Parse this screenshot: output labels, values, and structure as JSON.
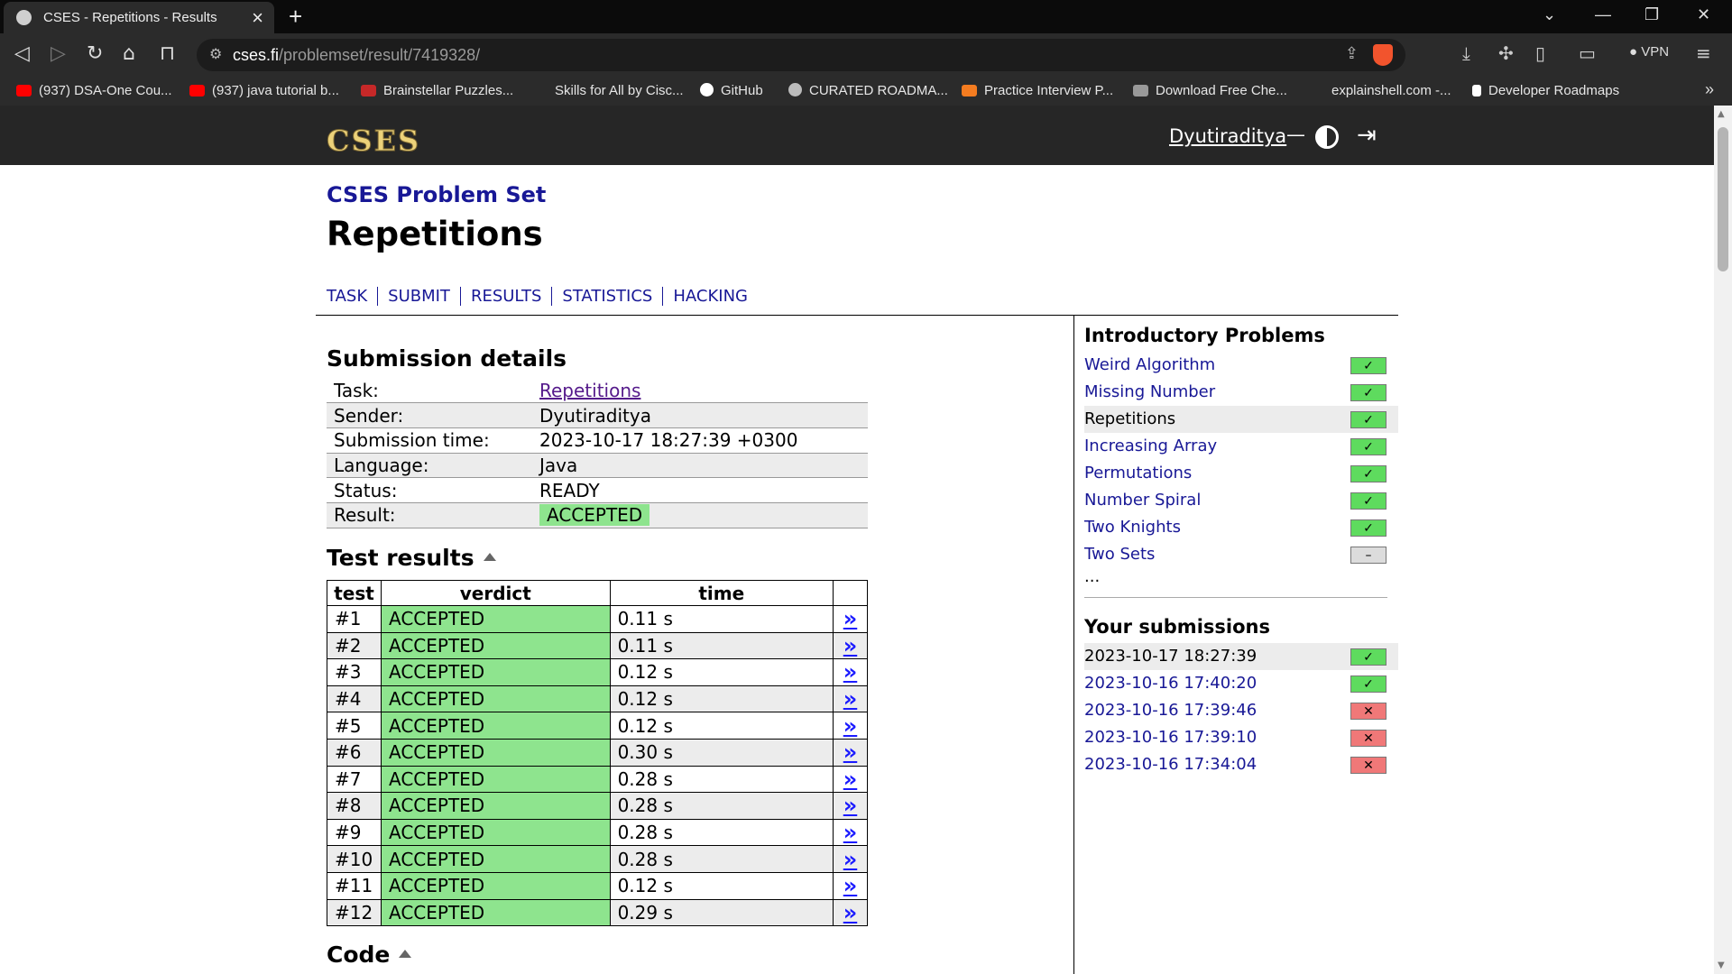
{
  "browser": {
    "tab_title": "CSES - Repetitions - Results",
    "url_host": "cses.fi",
    "url_path": "/problemset/result/7419328/",
    "vpn_label": "VPN",
    "bookmarks": [
      {
        "label": "(937) DSA-One Cou...",
        "icon": "youtube-icon"
      },
      {
        "label": "(937) java tutorial b...",
        "icon": "youtube-icon"
      },
      {
        "label": "Brainstellar Puzzles...",
        "icon": "star-icon"
      },
      {
        "label": "Skills for All by Cisc...",
        "icon": "cisco-icon"
      },
      {
        "label": "GitHub",
        "icon": "github-icon"
      },
      {
        "label": "CURATED ROADMA...",
        "icon": "globe-icon"
      },
      {
        "label": "Practice Interview P...",
        "icon": "codechef-icon"
      },
      {
        "label": "Download Free Che...",
        "icon": "bracket-icon"
      },
      {
        "label": "explainshell.com -...",
        "icon": "none"
      },
      {
        "label": "Developer Roadmaps",
        "icon": "roadmap-icon"
      }
    ]
  },
  "header": {
    "logo": "CSES",
    "username": "Dyutiraditya",
    "separator": "—"
  },
  "page": {
    "problemset_link": "CSES Problem Set",
    "title": "Repetitions",
    "tabs": [
      "TASK",
      "SUBMIT",
      "RESULTS",
      "STATISTICS",
      "HACKING"
    ]
  },
  "submission": {
    "heading": "Submission details",
    "rows": [
      {
        "key": "Task:",
        "value": "Repetitions"
      },
      {
        "key": "Sender:",
        "value": "Dyutiraditya"
      },
      {
        "key": "Submission time:",
        "value": "2023-10-17 18:27:39 +0300"
      },
      {
        "key": "Language:",
        "value": "Java"
      },
      {
        "key": "Status:",
        "value": "READY"
      },
      {
        "key": "Result:",
        "value": "ACCEPTED"
      }
    ]
  },
  "tests": {
    "heading": "Test results",
    "columns": [
      "test",
      "verdict",
      "time"
    ],
    "link_glyph": "»",
    "rows": [
      {
        "test": "#1",
        "verdict": "ACCEPTED",
        "time": "0.11 s"
      },
      {
        "test": "#2",
        "verdict": "ACCEPTED",
        "time": "0.11 s"
      },
      {
        "test": "#3",
        "verdict": "ACCEPTED",
        "time": "0.12 s"
      },
      {
        "test": "#4",
        "verdict": "ACCEPTED",
        "time": "0.12 s"
      },
      {
        "test": "#5",
        "verdict": "ACCEPTED",
        "time": "0.12 s"
      },
      {
        "test": "#6",
        "verdict": "ACCEPTED",
        "time": "0.30 s"
      },
      {
        "test": "#7",
        "verdict": "ACCEPTED",
        "time": "0.28 s"
      },
      {
        "test": "#8",
        "verdict": "ACCEPTED",
        "time": "0.28 s"
      },
      {
        "test": "#9",
        "verdict": "ACCEPTED",
        "time": "0.28 s"
      },
      {
        "test": "#10",
        "verdict": "ACCEPTED",
        "time": "0.28 s"
      },
      {
        "test": "#11",
        "verdict": "ACCEPTED",
        "time": "0.12 s"
      },
      {
        "test": "#12",
        "verdict": "ACCEPTED",
        "time": "0.29 s"
      }
    ]
  },
  "code_heading": "Code",
  "sidebar": {
    "problems_heading": "Introductory Problems",
    "problems": [
      {
        "name": "Weird Algorithm",
        "status": "solved",
        "current": false
      },
      {
        "name": "Missing Number",
        "status": "solved",
        "current": false
      },
      {
        "name": "Repetitions",
        "status": "solved",
        "current": true
      },
      {
        "name": "Increasing Array",
        "status": "solved",
        "current": false
      },
      {
        "name": "Permutations",
        "status": "solved",
        "current": false
      },
      {
        "name": "Number Spiral",
        "status": "solved",
        "current": false
      },
      {
        "name": "Two Knights",
        "status": "solved",
        "current": false
      },
      {
        "name": "Two Sets",
        "status": "attempted",
        "current": false
      }
    ],
    "ellipsis": "...",
    "submissions_heading": "Your submissions",
    "submissions": [
      {
        "time": "2023-10-17 18:27:39",
        "status": "accepted",
        "current": true
      },
      {
        "time": "2023-10-16 17:40:20",
        "status": "accepted",
        "current": false
      },
      {
        "time": "2023-10-16 17:39:46",
        "status": "rejected",
        "current": false
      },
      {
        "time": "2023-10-16 17:39:10",
        "status": "rejected",
        "current": false
      },
      {
        "time": "2023-10-16 17:34:04",
        "status": "rejected",
        "current": false
      }
    ]
  },
  "status_glyphs": {
    "solved": "✓",
    "accepted": "✓",
    "rejected": "✕",
    "attempted": "–"
  },
  "colors": {
    "accepted": "#8ee48e",
    "link": "#181896",
    "rejected": "#f07878"
  }
}
